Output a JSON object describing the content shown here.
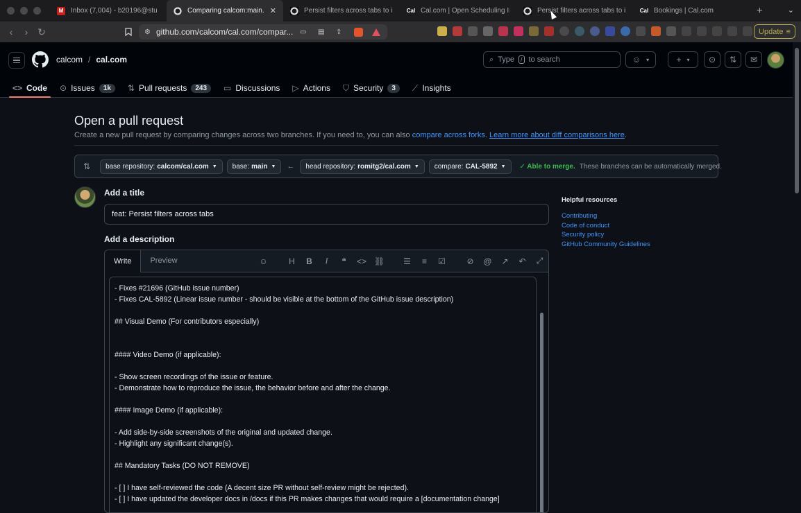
{
  "browser": {
    "tabs": [
      {
        "label": "Inbox (7,004) - b20196@stu",
        "icon": "gmail-icon",
        "color": "#c5221f",
        "glyph": "M"
      },
      {
        "label": "Comparing calcom:main...",
        "icon": "github-icon",
        "color": "#2e2e31",
        "glyph": "",
        "active": true
      },
      {
        "label": "Persist filters across tabs to in",
        "icon": "github-icon",
        "color": "#000000",
        "glyph": ""
      },
      {
        "label": "Cal.com | Open Scheduling In",
        "icon": "calcom-icon",
        "color": "#1c1c1e",
        "glyph": "Cal"
      },
      {
        "label": "Persist filters across tabs to in",
        "icon": "github-icon",
        "color": "#000000",
        "glyph": ""
      },
      {
        "label": "Bookings | Cal.com",
        "icon": "calcom-icon",
        "color": "#1c1c1e",
        "glyph": "Cal"
      }
    ],
    "close_glyph": "✕",
    "new_tab_glyph": "+",
    "menu_glyph": "⌄",
    "url": "github.com/calcom/cal.com/compar...",
    "update_label": "Update"
  },
  "header": {
    "owner": "calcom",
    "separator": "/",
    "repo": "cal.com",
    "search_prefix": "Type",
    "search_key": "/",
    "search_suffix": "to search"
  },
  "repo_nav": [
    {
      "label": "Code",
      "icon": "code-icon",
      "glyph": "<>",
      "selected": true
    },
    {
      "label": "Issues",
      "icon": "issue-icon",
      "glyph": "⊙",
      "count": "1k"
    },
    {
      "label": "Pull requests",
      "icon": "pull-request-icon",
      "glyph": "⇅",
      "count": "243"
    },
    {
      "label": "Discussions",
      "icon": "discussions-icon",
      "glyph": "▭"
    },
    {
      "label": "Actions",
      "icon": "actions-icon",
      "glyph": "▷"
    },
    {
      "label": "Security",
      "icon": "shield-icon",
      "glyph": "⛉",
      "count": "3"
    },
    {
      "label": "Insights",
      "icon": "graph-icon",
      "glyph": "⟋"
    }
  ],
  "page": {
    "title": "Open a pull request",
    "subtitle_text": "Create a new pull request by comparing changes across two branches. If you need to, you can also ",
    "link_forks": "compare across forks",
    "subtitle_mid": ". ",
    "link_learn": "Learn more about diff comparisons here",
    "subtitle_end": "."
  },
  "compare": {
    "base_repo_label": "base repository:",
    "base_repo_value": "calcom/cal.com",
    "base_label": "base:",
    "base_value": "main",
    "head_repo_label": "head repository:",
    "head_repo_value": "romitg2/cal.com",
    "compare_label": "compare:",
    "compare_value": "CAL-5892",
    "merge_status": "✓ Able to merge.",
    "merge_detail": "These branches can be automatically merged."
  },
  "form": {
    "title_label": "Add a title",
    "title_value": "feat: Persist filters across tabs",
    "description_label": "Add a description",
    "tab_write": "Write",
    "tab_preview": "Preview",
    "description_value": "- Fixes #21696 (GitHub issue number)\n- Fixes CAL-5892 (Linear issue number - should be visible at the bottom of the GitHub issue description)\n\n## Visual Demo (For contributors especially)\n\n\n#### Video Demo (if applicable):\n\n- Show screen recordings of the issue or feature.\n- Demonstrate how to reproduce the issue, the behavior before and after the change.\n\n#### Image Demo (if applicable):\n\n- Add side-by-side screenshots of the original and updated change.\n- Highlight any significant change(s).\n\n## Mandatory Tasks (DO NOT REMOVE)\n\n- [ ] I have self-reviewed the code (A decent size PR without self-review might be rejected).\n- [ ] I have updated the developer docs in /docs if this PR makes changes that would require a [documentation change]"
  },
  "resources": {
    "heading": "Helpful resources",
    "links": [
      "Contributing",
      "Code of conduct",
      "Security policy",
      "GitHub Community Guidelines"
    ]
  }
}
